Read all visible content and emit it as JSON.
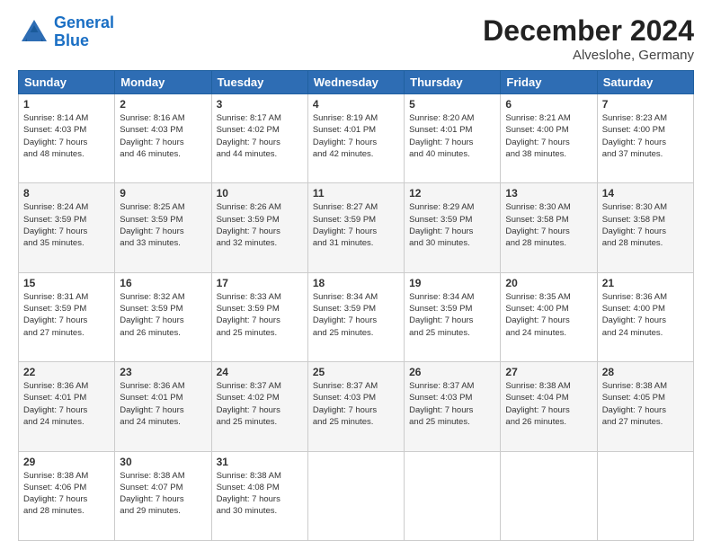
{
  "header": {
    "logo_line1": "General",
    "logo_line2": "Blue",
    "month": "December 2024",
    "location": "Alveslohe, Germany"
  },
  "weekdays": [
    "Sunday",
    "Monday",
    "Tuesday",
    "Wednesday",
    "Thursday",
    "Friday",
    "Saturday"
  ],
  "weeks": [
    [
      {
        "day": "1",
        "sunrise": "8:14 AM",
        "sunset": "4:03 PM",
        "daylight": "7 hours and 48 minutes."
      },
      {
        "day": "2",
        "sunrise": "8:16 AM",
        "sunset": "4:03 PM",
        "daylight": "7 hours and 46 minutes."
      },
      {
        "day": "3",
        "sunrise": "8:17 AM",
        "sunset": "4:02 PM",
        "daylight": "7 hours and 44 minutes."
      },
      {
        "day": "4",
        "sunrise": "8:19 AM",
        "sunset": "4:01 PM",
        "daylight": "7 hours and 42 minutes."
      },
      {
        "day": "5",
        "sunrise": "8:20 AM",
        "sunset": "4:01 PM",
        "daylight": "7 hours and 40 minutes."
      },
      {
        "day": "6",
        "sunrise": "8:21 AM",
        "sunset": "4:00 PM",
        "daylight": "7 hours and 38 minutes."
      },
      {
        "day": "7",
        "sunrise": "8:23 AM",
        "sunset": "4:00 PM",
        "daylight": "7 hours and 37 minutes."
      }
    ],
    [
      {
        "day": "8",
        "sunrise": "8:24 AM",
        "sunset": "3:59 PM",
        "daylight": "7 hours and 35 minutes."
      },
      {
        "day": "9",
        "sunrise": "8:25 AM",
        "sunset": "3:59 PM",
        "daylight": "7 hours and 33 minutes."
      },
      {
        "day": "10",
        "sunrise": "8:26 AM",
        "sunset": "3:59 PM",
        "daylight": "7 hours and 32 minutes."
      },
      {
        "day": "11",
        "sunrise": "8:27 AM",
        "sunset": "3:59 PM",
        "daylight": "7 hours and 31 minutes."
      },
      {
        "day": "12",
        "sunrise": "8:29 AM",
        "sunset": "3:59 PM",
        "daylight": "7 hours and 30 minutes."
      },
      {
        "day": "13",
        "sunrise": "8:30 AM",
        "sunset": "3:58 PM",
        "daylight": "7 hours and 28 minutes."
      },
      {
        "day": "14",
        "sunrise": "8:30 AM",
        "sunset": "3:58 PM",
        "daylight": "7 hours and 28 minutes."
      }
    ],
    [
      {
        "day": "15",
        "sunrise": "8:31 AM",
        "sunset": "3:59 PM",
        "daylight": "7 hours and 27 minutes."
      },
      {
        "day": "16",
        "sunrise": "8:32 AM",
        "sunset": "3:59 PM",
        "daylight": "7 hours and 26 minutes."
      },
      {
        "day": "17",
        "sunrise": "8:33 AM",
        "sunset": "3:59 PM",
        "daylight": "7 hours and 25 minutes."
      },
      {
        "day": "18",
        "sunrise": "8:34 AM",
        "sunset": "3:59 PM",
        "daylight": "7 hours and 25 minutes."
      },
      {
        "day": "19",
        "sunrise": "8:34 AM",
        "sunset": "3:59 PM",
        "daylight": "7 hours and 25 minutes."
      },
      {
        "day": "20",
        "sunrise": "8:35 AM",
        "sunset": "4:00 PM",
        "daylight": "7 hours and 24 minutes."
      },
      {
        "day": "21",
        "sunrise": "8:36 AM",
        "sunset": "4:00 PM",
        "daylight": "7 hours and 24 minutes."
      }
    ],
    [
      {
        "day": "22",
        "sunrise": "8:36 AM",
        "sunset": "4:01 PM",
        "daylight": "7 hours and 24 minutes."
      },
      {
        "day": "23",
        "sunrise": "8:36 AM",
        "sunset": "4:01 PM",
        "daylight": "7 hours and 24 minutes."
      },
      {
        "day": "24",
        "sunrise": "8:37 AM",
        "sunset": "4:02 PM",
        "daylight": "7 hours and 25 minutes."
      },
      {
        "day": "25",
        "sunrise": "8:37 AM",
        "sunset": "4:03 PM",
        "daylight": "7 hours and 25 minutes."
      },
      {
        "day": "26",
        "sunrise": "8:37 AM",
        "sunset": "4:03 PM",
        "daylight": "7 hours and 25 minutes."
      },
      {
        "day": "27",
        "sunrise": "8:38 AM",
        "sunset": "4:04 PM",
        "daylight": "7 hours and 26 minutes."
      },
      {
        "day": "28",
        "sunrise": "8:38 AM",
        "sunset": "4:05 PM",
        "daylight": "7 hours and 27 minutes."
      }
    ],
    [
      {
        "day": "29",
        "sunrise": "8:38 AM",
        "sunset": "4:06 PM",
        "daylight": "7 hours and 28 minutes."
      },
      {
        "day": "30",
        "sunrise": "8:38 AM",
        "sunset": "4:07 PM",
        "daylight": "7 hours and 29 minutes."
      },
      {
        "day": "31",
        "sunrise": "8:38 AM",
        "sunset": "4:08 PM",
        "daylight": "7 hours and 30 minutes."
      },
      null,
      null,
      null,
      null
    ]
  ]
}
